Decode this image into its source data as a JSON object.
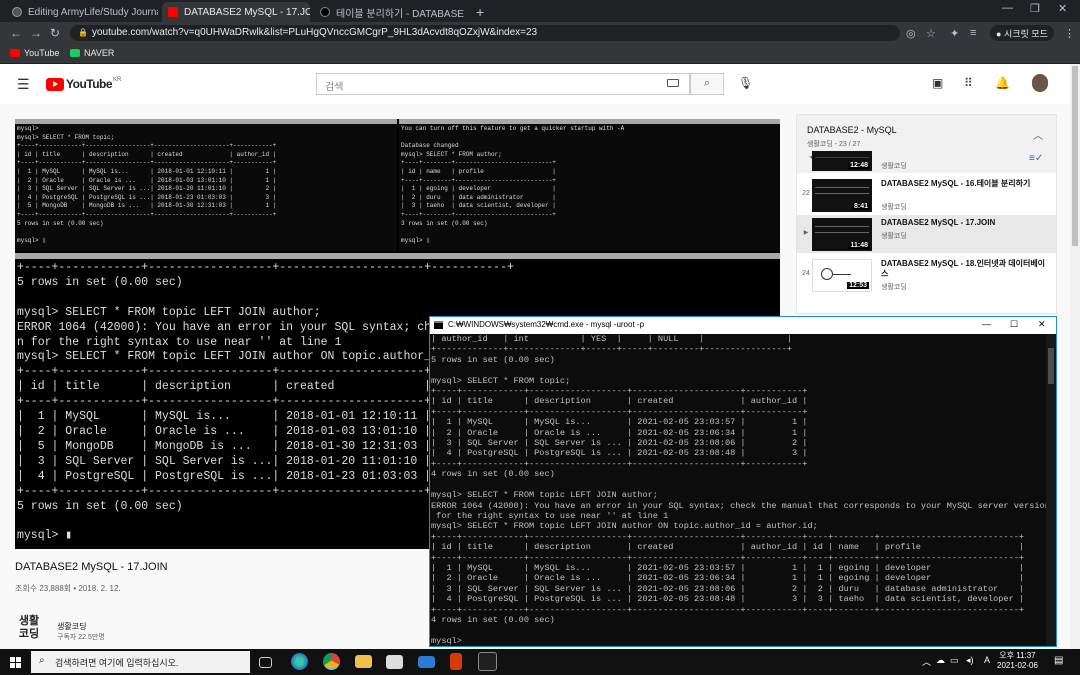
{
  "browser": {
    "tabs": [
      {
        "title": "Editing ArmyLife/Study Journal",
        "favicon_color": "#555555",
        "active": false
      },
      {
        "title": "DATABASE2 MySQL - 17.JOI",
        "favicon_color": "#ff0000",
        "active": true
      },
      {
        "title": "테이블 분리하기 - DATABASE 2",
        "favicon_color": "#000000",
        "active": false
      }
    ],
    "new_tab_label": "+",
    "url": "youtube.com/watch?v=q0UHWaDRwlk&list=PLuHgQVnccGMCgrP_9HL3dAcvdt8qOZxjW&index=23",
    "profile_label": "시크릿 모드",
    "bookmarks": [
      {
        "label": "YouTube",
        "color": "#ff0000"
      },
      {
        "label": "NAVER",
        "color": "#19ce60"
      }
    ]
  },
  "youtube": {
    "logo_text": "YouTube",
    "logo_region": "KR",
    "search_placeholder": "검색",
    "video": {
      "title": "DATABASE2 MySQL - 17.JOIN",
      "meta": "조회수 23,888회 • 2018. 2. 12."
    },
    "channel": {
      "logo_text": "생활\n코딩",
      "name": "생활코딩",
      "subscribers": "구독자 22.5만명"
    },
    "playlist": {
      "title": "DATABASE2 - MySQL",
      "subtitle": "생활코딩 - 23 / 27",
      "items": [
        {
          "index": "",
          "title": "",
          "channel": "생활코딩",
          "duration": "12:48",
          "current": false
        },
        {
          "index": "22",
          "title": "DATABASE2 MySQL - 16.테이블 분리하기",
          "channel": "생활코딩",
          "duration": "8:41",
          "current": false
        },
        {
          "index": "▶",
          "title": "DATABASE2 MySQL - 17.JOIN",
          "channel": "생활코딩",
          "duration": "11:48",
          "current": true
        },
        {
          "index": "24",
          "title": "DATABASE2 MySQL - 18.인터넷과 데이터베이스",
          "channel": "생활코딩",
          "duration": "12:53",
          "current": false
        }
      ]
    }
  },
  "video_frame": {
    "top_left_terminal": "mysql>\nmysql> SELECT * FROM topic;\n+----+------------+------------------+---------------------+-----------+\n| id | title      | description      | created             | author_id |\n+----+------------+------------------+---------------------+-----------+\n|  1 | MySQL      | MySQL is...      | 2018-01-01 12:10:11 |         1 |\n|  2 | Oracle     | Oracle is ...    | 2018-01-03 13:01:10 |         1 |\n|  3 | SQL Server | SQL Server is ...| 2018-01-20 11:01:10 |         2 |\n|  4 | PostgreSQL | PostgreSQL is ...| 2018-01-23 01:03:03 |         3 |\n|  5 | MongoDB    | MongoDB is ...   | 2018-01-30 12:31:03 |         1 |\n+----+------------+------------------+---------------------+-----------+\n5 rows in set (0.00 sec)\n\nmysql> ▯",
    "top_right_terminal": "You can turn off this feature to get a quicker startup with -A\n\nDatabase changed\nmysql> SELECT * FROM author;\n+----+--------+---------------------------+\n| id | name   | profile                   |\n+----+--------+---------------------------+\n|  1 | egoing | developer                 |\n|  2 | duru   | data administrator        |\n|  3 | taeho  | data scientist, developer |\n+----+--------+---------------------------+\n3 rows in set (0.00 sec)\n\nmysql> ▯",
    "main_terminal": "+----+------------+------------------+---------------------+-----------+\n5 rows in set (0.00 sec)\n\nmysql> SELECT * FROM topic LEFT JOIN author;\nERROR 1064 (42000): You have an error in your SQL syntax; check the manual that corresponds to your MySQL server version fo\nn for the right syntax to use near '' at line 1\nmysql> SELECT * FROM topic LEFT JOIN author ON topic.author_id = author.id;\n+----+------------+------------------+---------------------+-----------+------+--------+---------------------------+\n| id | title      | description      | created             | author_id | id   | name   | profile                   |\n+----+------------+------------------+---------------------+-----------+------+--------+---------------------------+\n|  1 | MySQL      | MySQL is...      | 2018-01-01 12:10:11 |         1 |    1 | egoing | developer                 |\n|  2 | Oracle     | Oracle is ...    | 2018-01-03 13:01:10 |         1 |    1 | egoing | developer                 |\n|  5 | MongoDB    | MongoDB is ...   | 2018-01-30 12:31:03 |         1 |    1 | egoing | developer                 |\n|  3 | SQL Server | SQL Server is ...| 2018-01-20 11:01:10 |         2 |    2 | duru   | data administrator        |\n|  4 | PostgreSQL | PostgreSQL is ...| 2018-01-23 01:03:03 |         3 |    3 | taeho  | data scientist, developer |\n+----+------------+------------------+---------------------+-----------+------+--------+---------------------------+\n5 rows in set (0.00 sec)\n\nmysql> ▮"
  },
  "cmd_window": {
    "title": "C:₩WINDOWS₩system32₩cmd.exe - mysql  -uroot -p",
    "content": "| author_id   | int          | YES  |     | NULL    |                |\n+-------------+--------------+------+-----+---------+----------------+\n5 rows in set (0.00 sec)\n\nmysql> SELECT * FROM topic;\n+----+------------+-------------------+---------------------+-----------+\n| id | title      | description       | created             | author_id |\n+----+------------+-------------------+---------------------+-----------+\n|  1 | MySQL      | MySQL is...       | 2021-02-05 23:03:57 |         1 |\n|  2 | Oracle     | Oracle is ...     | 2021-02-05 23:06:34 |         1 |\n|  3 | SQL Server | SQL Server is ... | 2021-02-05 23:08:06 |         2 |\n|  4 | PostgreSQL | PostgreSQL is ... | 2021-02-05 23:08:48 |         3 |\n+----+------------+-------------------+---------------------+-----------+\n4 rows in set (0.00 sec)\n\nmysql> SELECT * FROM topic LEFT JOIN author;\nERROR 1064 (42000): You have an error in your SQL syntax; check the manual that corresponds to your MySQL server version\n for the right syntax to use near '' at line 1\nmysql> SELECT * FROM topic LEFT JOIN author ON topic.author_id = author.id;\n+----+------------+-------------------+---------------------+-----------+----+--------+---------------------------+\n| id | title      | description       | created             | author_id | id | name   | profile                   |\n+----+------------+-------------------+---------------------+-----------+----+--------+---------------------------+\n|  1 | MySQL      | MySQL is...       | 2021-02-05 23:03:57 |         1 |  1 | egoing | developer                 |\n|  2 | Oracle     | Oracle is ...     | 2021-02-05 23:06:34 |         1 |  1 | egoing | developer                 |\n|  3 | SQL Server | SQL Server is ... | 2021-02-05 23:08:06 |         2 |  2 | duru   | database administrator    |\n|  4 | PostgreSQL | PostgreSQL is ... | 2021-02-05 23:08:48 |         3 |  3 | taeho  | data scientist, developer |\n+----+------------+-------------------+---------------------+-----------+----+--------+---------------------------+\n4 rows in set (0.00 sec)\n\nmysql>"
  },
  "taskbar": {
    "search_placeholder": "검색하려면 여기에 입력하십시오.",
    "ime": "A",
    "time_period": "오후 11:37",
    "date": "2021-02-06"
  }
}
